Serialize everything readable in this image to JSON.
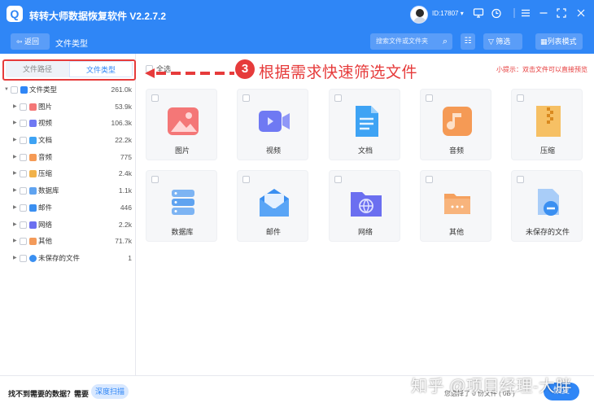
{
  "app": {
    "title": "转转大师数据恢复软件 V2.2.7.2",
    "logo_letter": "Q",
    "user_id": "ID:17807",
    "accent": "#2f86f6",
    "window_icons": [
      "dropdown-icon",
      "monitor-icon",
      "timer-icon",
      "menu-icon",
      "minimize-icon",
      "maximize-icon",
      "close-icon"
    ]
  },
  "toolbar": {
    "back_label": "返回",
    "breadcrumb": "文件类型",
    "search_placeholder": "搜索文件或文件夹",
    "filter_label": "筛选",
    "list_mode_label": "列表模式"
  },
  "sidebar": {
    "tabs": [
      {
        "label": "文件路径",
        "active": false
      },
      {
        "label": "文件类型",
        "active": true
      }
    ],
    "tree": [
      {
        "label": "文件类型",
        "count": "261.0k",
        "root": true,
        "color": "#2f86f6"
      },
      {
        "label": "图片",
        "count": "53.9k",
        "color": "#f47777"
      },
      {
        "label": "视频",
        "count": "106.3k",
        "color": "#6f79f3"
      },
      {
        "label": "文档",
        "count": "22.2k",
        "color": "#3ea3f4"
      },
      {
        "label": "音频",
        "count": "775",
        "color": "#f59a55"
      },
      {
        "label": "压缩",
        "count": "2.4k",
        "color": "#f1b24a"
      },
      {
        "label": "数据库",
        "count": "1.1k",
        "color": "#5fa3f0"
      },
      {
        "label": "邮件",
        "count": "446",
        "color": "#3a8ff1"
      },
      {
        "label": "网络",
        "count": "2.2k",
        "color": "#6b6ff0"
      },
      {
        "label": "其他",
        "count": "71.7k",
        "color": "#f39a5a"
      },
      {
        "label": "未保存的文件",
        "count": "1",
        "color": "#3a8ff1"
      }
    ]
  },
  "content": {
    "select_all_label": "全选",
    "annotation_number": "3",
    "annotation_text": "根据需求快速筛选文件",
    "hint": "小提示：双击文件可以直接预览",
    "cards": [
      {
        "label": "图片",
        "icon": "image-icon"
      },
      {
        "label": "视频",
        "icon": "video-icon"
      },
      {
        "label": "文档",
        "icon": "document-icon"
      },
      {
        "label": "音频",
        "icon": "audio-icon"
      },
      {
        "label": "压缩",
        "icon": "archive-icon"
      },
      {
        "label": "数据库",
        "icon": "database-icon"
      },
      {
        "label": "邮件",
        "icon": "mail-icon"
      },
      {
        "label": "网络",
        "icon": "network-icon"
      },
      {
        "label": "其他",
        "icon": "folder-icon"
      },
      {
        "label": "未保存的文件",
        "icon": "unsaved-file-icon"
      }
    ]
  },
  "footer": {
    "lost_text": "找不到需要的数据？需要",
    "deep_scan_label": "深度扫描",
    "selection_text": "您选择了 0 份文件 ( 0B )",
    "recover_label": "恢复"
  },
  "watermark": "知乎 @项目经理-大胖"
}
